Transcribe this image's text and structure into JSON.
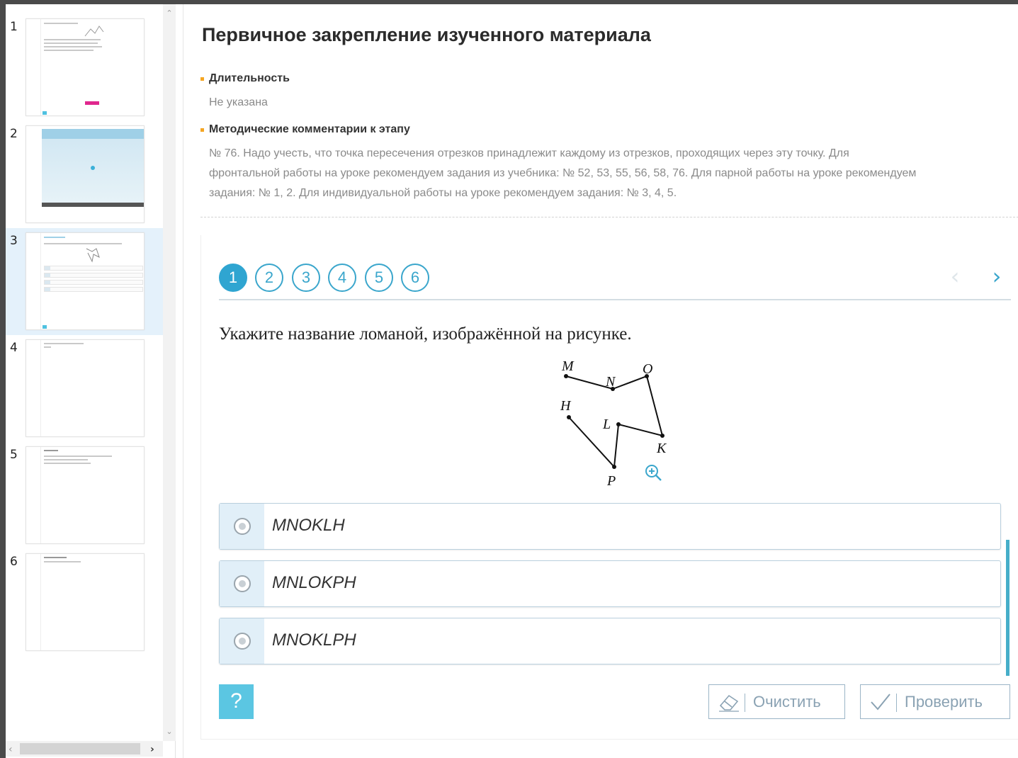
{
  "sidebar": {
    "thumbnails": [
      {
        "number": "1"
      },
      {
        "number": "2"
      },
      {
        "number": "3"
      },
      {
        "number": "4"
      },
      {
        "number": "5"
      },
      {
        "number": "6"
      }
    ],
    "active_index": 2
  },
  "main": {
    "title": "Первичное закрепление изученного материала",
    "duration_label": "Длительность",
    "duration_value": "Не указана",
    "comments_label": "Методические комментарии к этапу",
    "comments_lines": [
      "№ 76. Надо учесть, что точка пересечения отрезков принадлежит каждому из отрезков, проходящих через эту точку. Для",
      "фронтальной работы на уроке рекомендуем задания из учебника: № 52, 53, 55, 56, 58, 76. Для парной работы на уроке рекомендуем",
      "задания: № 1, 2. Для индивидуальной работы на уроке рекомендуем задания: № 3, 4, 5."
    ]
  },
  "task": {
    "steps": [
      "1",
      "2",
      "3",
      "4",
      "5",
      "6"
    ],
    "active_step": 0,
    "question": "Укажите название ломаной, изображённой на рисунке.",
    "figure_labels": {
      "M": "M",
      "N": "N",
      "O": "O",
      "H": "H",
      "L": "L",
      "K": "K",
      "P": "P"
    },
    "answers": [
      "MNOKLH",
      "MNLOKPH",
      "MNOKLPH"
    ],
    "help_label": "?",
    "clear_label": "Очистить",
    "check_label": "Проверить"
  },
  "colors": {
    "accent": "#2fa5d1",
    "help": "#5bc6e2",
    "bullet": "#f5a623",
    "answer_radio_bg": "#e1eff8"
  },
  "icons": [
    "zoom-in-icon",
    "eraser-icon",
    "check-icon",
    "chevron-left-icon",
    "chevron-right-icon",
    "chevron-up-icon",
    "chevron-down-icon"
  ]
}
